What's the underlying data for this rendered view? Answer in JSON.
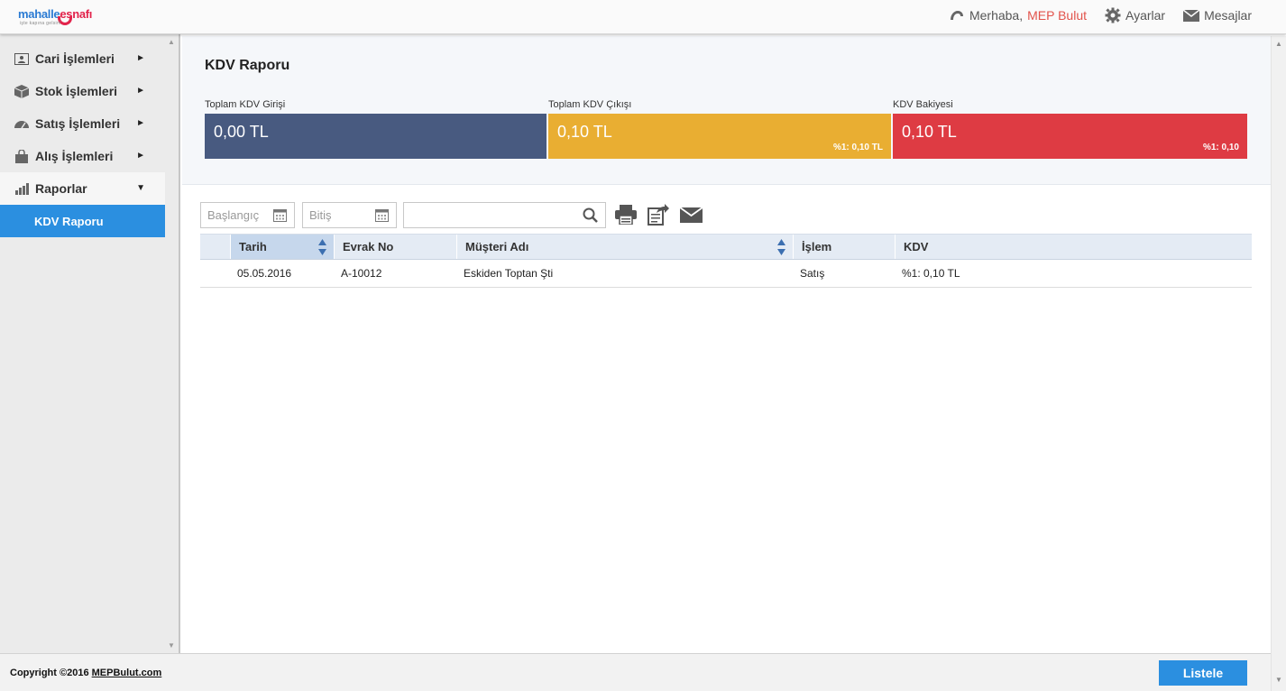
{
  "brand": {
    "part1": "mahalle",
    "part2": "esnafı",
    "tagline": "işte kapına gelsin!"
  },
  "topnav": {
    "greeting": "Merhaba,",
    "user": "MEP Bulut",
    "settings": "Ayarlar",
    "messages": "Mesajlar"
  },
  "sidebar": {
    "items": [
      {
        "label": "Cari İşlemleri",
        "icon": "contact-card-icon",
        "arrow": "►"
      },
      {
        "label": "Stok İşlemleri",
        "icon": "box-icon",
        "arrow": "►"
      },
      {
        "label": "Satış İşlemleri",
        "icon": "speedometer-icon",
        "arrow": "►"
      },
      {
        "label": "Alış İşlemleri",
        "icon": "shopping-bag-icon",
        "arrow": "►"
      },
      {
        "label": "Raporlar",
        "icon": "bar-chart-icon",
        "arrow": "▼"
      }
    ],
    "active_sub": "KDV Raporu"
  },
  "page": {
    "title": "KDV Raporu"
  },
  "stats": [
    {
      "label": "Toplam KDV Girişi",
      "value": "0,00 TL",
      "sub": "",
      "color": "#485a80"
    },
    {
      "label": "Toplam KDV Çıkışı",
      "value": "0,10 TL",
      "sub": "%1: 0,10 TL",
      "color": "#e9ae32"
    },
    {
      "label": "KDV Bakiyesi",
      "value": "0,10 TL",
      "sub": "%1: 0,10",
      "color": "#de3b43"
    }
  ],
  "filters": {
    "start_placeholder": "Başlangıç",
    "end_placeholder": "Bitiş",
    "search_value": ""
  },
  "table": {
    "headers": [
      "Tarih",
      "Evrak No",
      "Müşteri Adı",
      "İşlem",
      "KDV"
    ],
    "rows": [
      [
        "05.05.2016",
        "A-10012",
        "Eskiden Toptan Şti",
        "Satış",
        "%1: 0,10 TL"
      ]
    ]
  },
  "footer": {
    "copyright": "Copyright ©2016",
    "link": "MEPBulut.com",
    "list_button": "Listele"
  }
}
